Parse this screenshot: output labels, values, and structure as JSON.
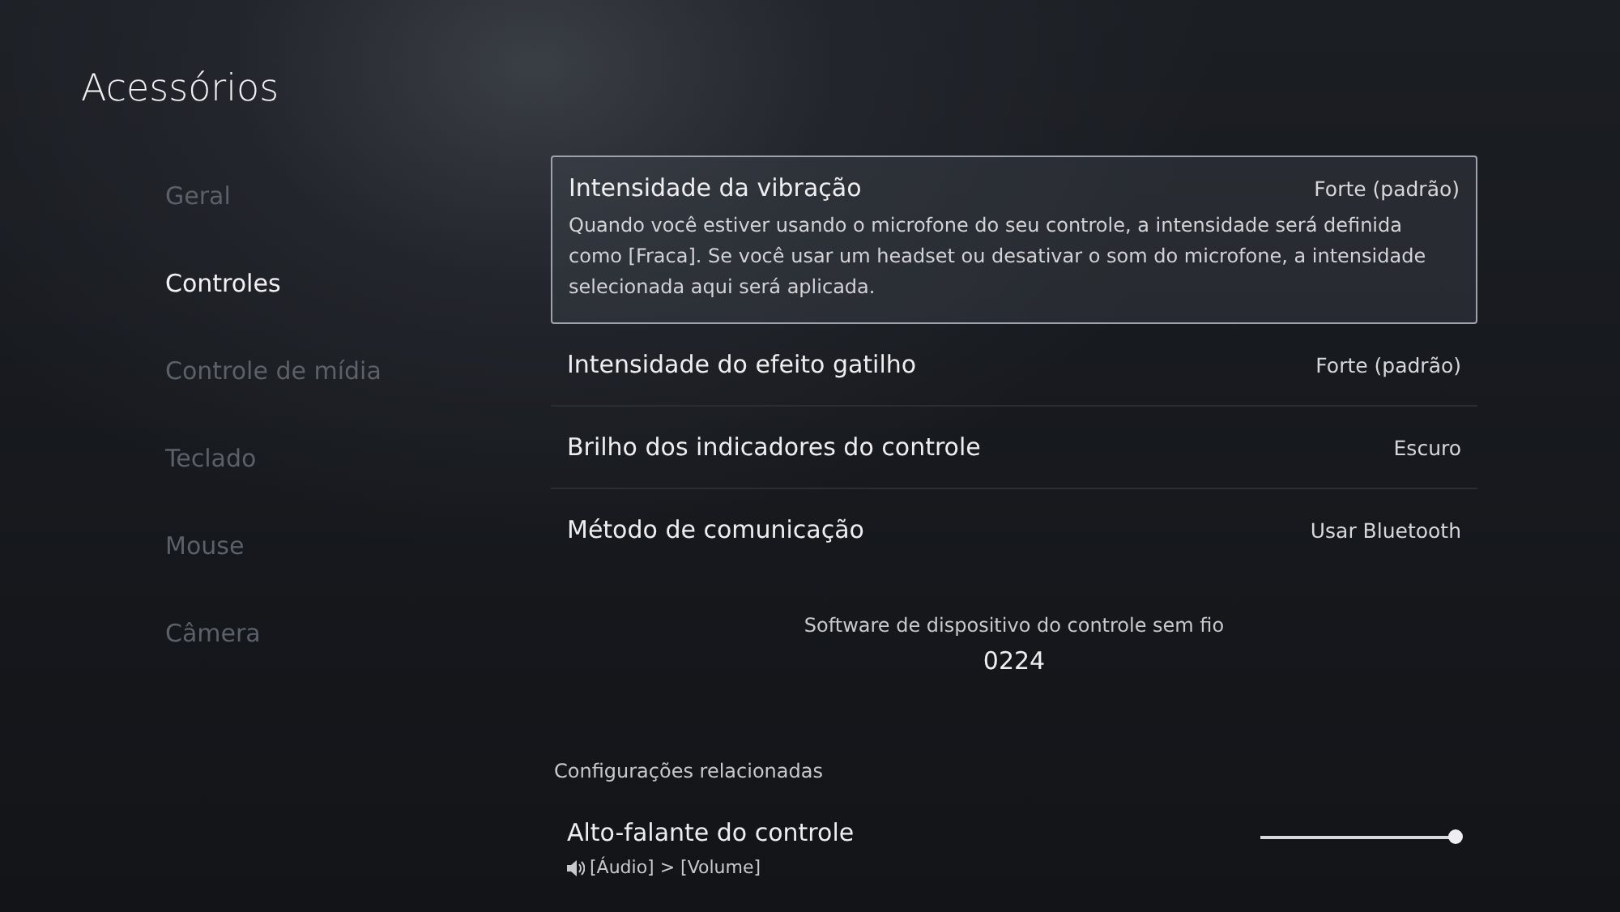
{
  "header": {
    "title": "Acessórios"
  },
  "sidebar": {
    "items": [
      {
        "label": "Geral",
        "selected": false
      },
      {
        "label": "Controles",
        "selected": true
      },
      {
        "label": "Controle de mídia",
        "selected": false
      },
      {
        "label": "Teclado",
        "selected": false
      },
      {
        "label": "Mouse",
        "selected": false
      },
      {
        "label": "Câmera",
        "selected": false
      }
    ]
  },
  "settings": [
    {
      "label": "Intensidade da vibração",
      "value": "Forte (padrão)",
      "focused": true,
      "description": "Quando você estiver usando o microfone do seu controle, a intensidade será definida como [Fraca]. Se você usar um headset ou desativar o som do microfone, a intensidade selecionada aqui será aplicada."
    },
    {
      "label": "Intensidade do efeito gatilho",
      "value": "Forte (padrão)",
      "focused": false
    },
    {
      "label": "Brilho dos indicadores do controle",
      "value": "Escuro",
      "focused": false
    },
    {
      "label": "Método de comunicação",
      "value": "Usar Bluetooth",
      "focused": false
    }
  ],
  "firmware": {
    "label": "Software de dispositivo do controle sem fio",
    "version": "0224"
  },
  "related": {
    "heading": "Configurações relacionadas",
    "items": [
      {
        "label": "Alto-falante do controle",
        "path": "[Áudio] > [Volume]",
        "level": 1
      }
    ]
  }
}
